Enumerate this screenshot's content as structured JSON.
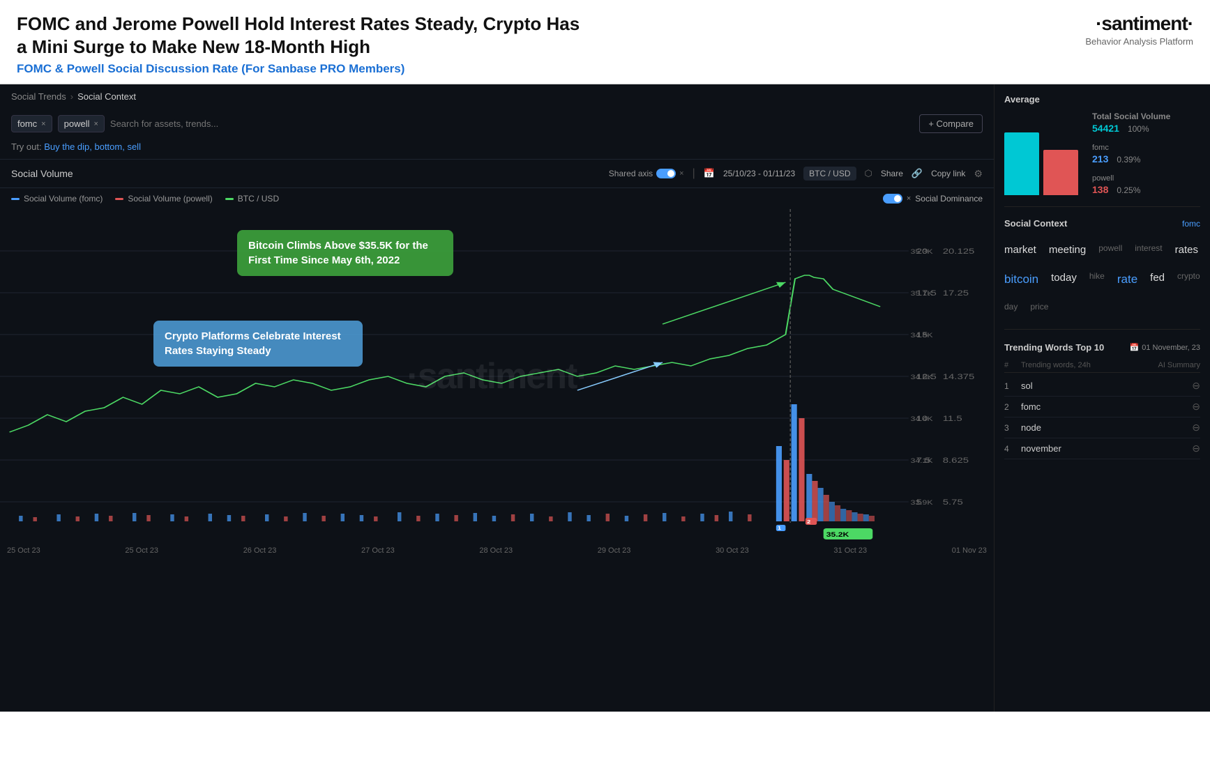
{
  "header": {
    "title": "FOMC and Jerome Powell Hold Interest Rates Steady, Crypto Has a Mini Surge to Make New 18-Month High",
    "subtitle": "FOMC & Powell Social Discussion Rate (For Sanbase PRO Members)",
    "logo": "·santiment·",
    "tagline": "Behavior Analysis Platform"
  },
  "breadcrumb": {
    "parent": "Social Trends",
    "current": "Social Context"
  },
  "search": {
    "tags": [
      "fomc",
      "powell"
    ],
    "placeholder": "Search for assets, trends...",
    "compare_label": "+ Compare"
  },
  "try_out": {
    "label": "Try out:",
    "links": "Buy the dip, bottom, sell"
  },
  "chart_toolbar": {
    "title": "Social Volume",
    "shared_axis": "Shared axis",
    "date_range": "25/10/23 - 01/11/23",
    "price_pair": "BTC / USD",
    "share": "Share",
    "copy_link": "Copy link"
  },
  "legend": {
    "items": [
      {
        "label": "Social Volume (fomc)",
        "color": "#4a9eff"
      },
      {
        "label": "Social Volume (powell)",
        "color": "#e05555"
      },
      {
        "label": "BTC / USD",
        "color": "#4cd964"
      }
    ]
  },
  "annotations": {
    "green": "Bitcoin Climbs Above $35.5K for the First Time Since May 6th, 2022",
    "blue": "Crypto Platforms Celebrate Interest Rates Staying Steady"
  },
  "social_dominance": "Social Dominance",
  "x_axis_labels": [
    "25 Oct 23",
    "25 Oct 23",
    "26 Oct 23",
    "27 Oct 23",
    "28 Oct 23",
    "29 Oct 23",
    "30 Oct 23",
    "31 Oct 23",
    "01 Nov 23"
  ],
  "right_panel": {
    "average_title": "Average",
    "total_label": "Total Social Volume",
    "total_value": "54421",
    "total_pct": "100%",
    "fomc_label": "fomc",
    "fomc_value": "213",
    "fomc_pct": "0.39%",
    "powell_label": "powell",
    "powell_value": "138",
    "powell_pct": "0.25%",
    "social_context_title": "Social Context",
    "social_context_tab": "fomc",
    "words": [
      {
        "text": "market",
        "size": "md",
        "color": "white"
      },
      {
        "text": "meeting",
        "size": "md",
        "color": "white"
      },
      {
        "text": "powell",
        "size": "sm",
        "color": "dim"
      },
      {
        "text": "interest",
        "size": "sm",
        "color": "dim"
      },
      {
        "text": "rates",
        "size": "md",
        "color": "white"
      },
      {
        "text": "bitcoin",
        "size": "lg",
        "color": "blue"
      },
      {
        "text": "today",
        "size": "md",
        "color": "white"
      },
      {
        "text": "hike",
        "size": "sm",
        "color": "dim"
      },
      {
        "text": "rate",
        "size": "lg",
        "color": "blue"
      },
      {
        "text": "fed",
        "size": "md",
        "color": "white"
      },
      {
        "text": "crypto",
        "size": "sm",
        "color": "dim"
      },
      {
        "text": "day",
        "size": "sm",
        "color": "dim"
      },
      {
        "text": "price",
        "size": "sm",
        "color": "dim"
      }
    ],
    "trending_title": "Trending Words Top 10",
    "trending_date": "01 November, 23",
    "trending_col_num": "#",
    "trending_col_word": "Trending words, 24h",
    "trending_col_ai": "AI Summary",
    "trending_rows": [
      {
        "num": "1",
        "word": "sol"
      },
      {
        "num": "2",
        "word": "fomc"
      },
      {
        "num": "3",
        "word": "node"
      },
      {
        "num": "4",
        "word": "november"
      }
    ]
  }
}
